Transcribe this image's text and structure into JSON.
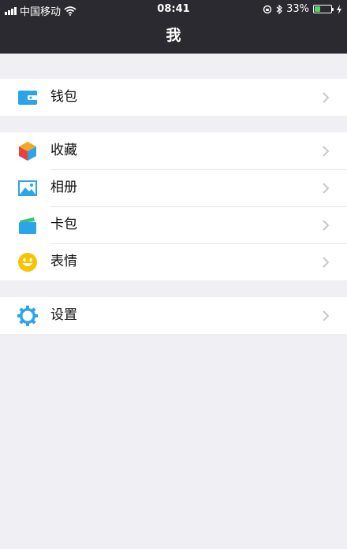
{
  "status_bar": {
    "carrier": "中国移动",
    "time": "08:41",
    "battery": "33%",
    "battery_level": 0.33
  },
  "nav": {
    "title": "我"
  },
  "groups": [
    {
      "items": [
        {
          "label": "钱包",
          "icon": "wallet-icon"
        }
      ]
    },
    {
      "items": [
        {
          "label": "收藏",
          "icon": "favorites-cube-icon"
        },
        {
          "label": "相册",
          "icon": "album-picture-icon"
        },
        {
          "label": "卡包",
          "icon": "card-pack-icon"
        },
        {
          "label": "表情",
          "icon": "sticker-smiley-icon"
        }
      ]
    },
    {
      "items": [
        {
          "label": "设置",
          "icon": "settings-gear-icon"
        }
      ]
    }
  ],
  "colors": {
    "nav_bg": "#2b2a30",
    "page_bg": "#efeff4",
    "accent_blue": "#2aa6e8",
    "battery_green": "#4cd964"
  }
}
